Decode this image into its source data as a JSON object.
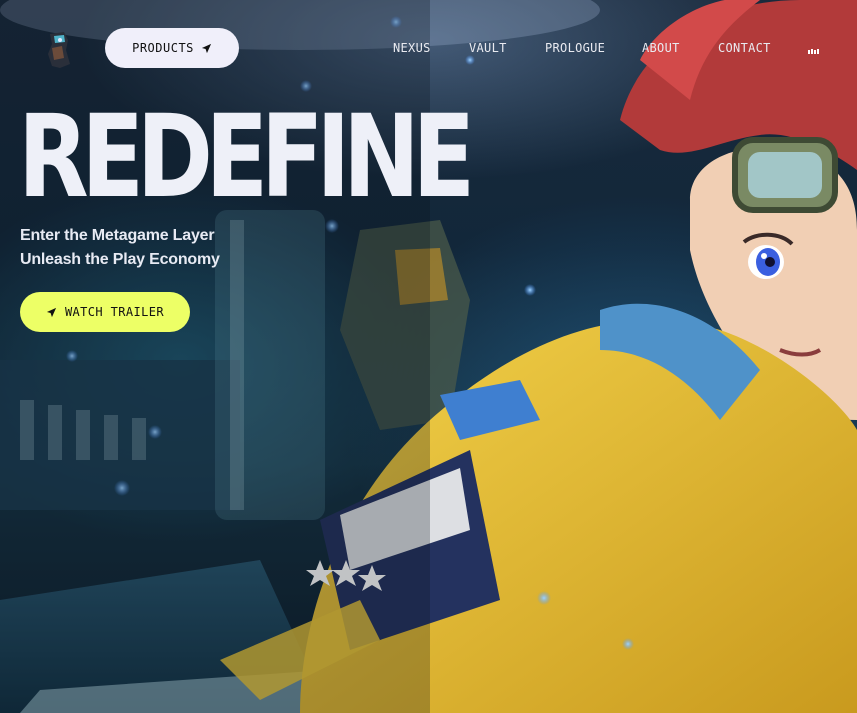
{
  "nav": {
    "logo_name": "brand-logo",
    "products_label": "PRODUCTS",
    "products_icon": "send-arrow-icon",
    "links": [
      "NEXUS",
      "VAULT",
      "PROLOGUE",
      "ABOUT",
      "CONTACT"
    ],
    "audio_icon": "audio-bars-icon"
  },
  "hero": {
    "headline": "REDEFINE",
    "tagline_line1": "Enter the Metagame Layer",
    "tagline_line2": "Unleash the Play Economy",
    "cta_label": "WATCH TRAILER",
    "cta_icon": "send-arrow-icon"
  },
  "colors": {
    "cta_background": "#edff66",
    "products_background": "#f0effa",
    "headline": "#eef0f8"
  }
}
